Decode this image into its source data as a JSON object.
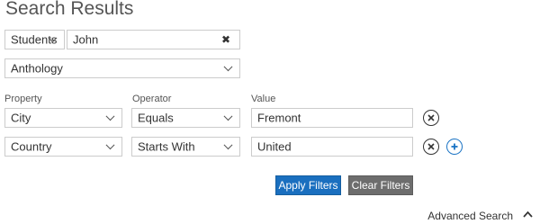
{
  "page": {
    "title": "Search Results"
  },
  "search": {
    "scope_select": "Students",
    "query_value": "John"
  },
  "collection_select": "Anthology",
  "filters": {
    "headers": {
      "property": "Property",
      "operator": "Operator",
      "value": "Value"
    },
    "rows": [
      {
        "property": "City",
        "operator": "Equals",
        "value": "Fremont"
      },
      {
        "property": "Country",
        "operator": "Starts With",
        "value": "United"
      }
    ]
  },
  "actions": {
    "apply_label": "Apply Filters",
    "clear_label": "Clear Filters"
  },
  "advanced": {
    "label": "Advanced Search"
  },
  "colors": {
    "primary": "#1a6fbf",
    "secondary": "#6d6d6d",
    "add_icon": "#1a73c4"
  },
  "icons": {
    "clear_query": "close-icon",
    "remove_filter": "remove-filter-icon",
    "add_filter": "add-filter-icon",
    "dropdown": "chevron-down-icon",
    "collapse": "chevron-up-icon"
  }
}
